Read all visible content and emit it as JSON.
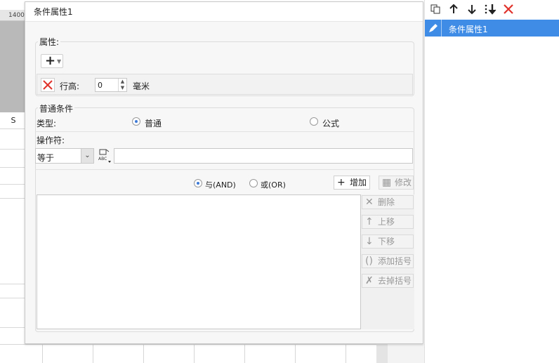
{
  "sheet": {
    "ruler_label": "1400",
    "column_label": "S"
  },
  "dialog": {
    "title": "条件属性1",
    "attributes": {
      "label": "属性:",
      "add_icon": "plus-icon",
      "row_height_label": "行高:",
      "row_height_value": "0",
      "unit_label": "毫米"
    },
    "common": {
      "label": "普通条件",
      "type_label": "类型:",
      "type_options": [
        "普通",
        "公式"
      ],
      "type_selected": "普通",
      "operator_label": "操作符:",
      "operator_value": "等于",
      "value_input": "",
      "logic_and": "与(AND)",
      "logic_or": "或(OR)",
      "logic_selected": "与(AND)",
      "buttons": {
        "add": "增加",
        "modify": "修改",
        "delete": "删除",
        "move_up": "上移",
        "move_down": "下移",
        "add_bracket": "添加括号",
        "remove_bracket": "去掉括号"
      }
    }
  },
  "right_panel": {
    "toolbar_icons": [
      "copy-icon",
      "arrow-up-icon",
      "arrow-down-icon",
      "move-bottom-icon",
      "delete-icon"
    ],
    "items": [
      {
        "label": "条件属性1",
        "selected": true
      }
    ]
  },
  "colors": {
    "accent": "#3e8ce6",
    "delete_red": "#e0322b"
  }
}
